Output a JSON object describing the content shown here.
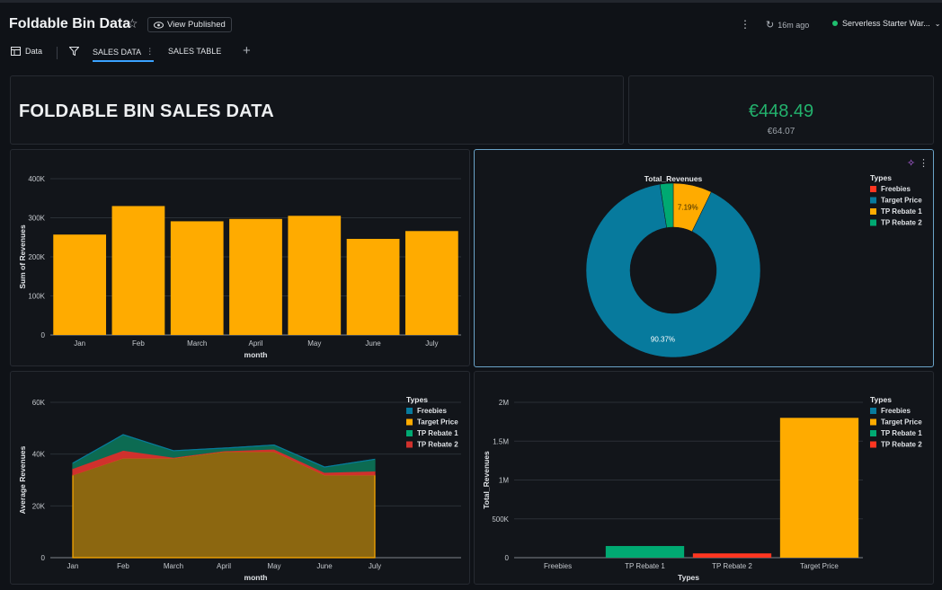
{
  "header": {
    "title": "Foldable Bin Data",
    "view_published": "View Published",
    "refreshed": "16m ago",
    "warehouse": "Serverless Starter War...",
    "status_color": "#1fbf6f"
  },
  "tabs": {
    "data_label": "Data",
    "sales_data": "SALES DATA",
    "sales_table": "SALES TABLE"
  },
  "banner": {
    "title": "FOLDABLE BIN SALES DATA"
  },
  "kpi": {
    "value": "€448.49",
    "sub": "€64.07"
  },
  "colors": {
    "orange": "#ffab00",
    "blue": "#077a9d",
    "green": "#00a972",
    "red": "#ff3621",
    "area_fill": "#8c6710"
  },
  "chart_data": [
    {
      "type": "bar",
      "xlabel": "month",
      "ylabel": "Sum of Revenues",
      "categories": [
        "Jan",
        "Feb",
        "March",
        "April",
        "May",
        "June",
        "July"
      ],
      "values": [
        257000,
        330000,
        291000,
        297000,
        305000,
        246000,
        266000
      ],
      "ylim": [
        0,
        400000
      ],
      "yticks": [
        "0",
        "100K",
        "200K",
        "300K",
        "400K"
      ],
      "color": "#ffab00"
    },
    {
      "type": "pie",
      "title": "Total_Revenues",
      "legend_title": "Types",
      "legend": [
        "Freebies",
        "Target Price",
        "TP Rebate 1",
        "TP Rebate 2"
      ],
      "slices": [
        {
          "name": "TP Rebate 1",
          "value": 7.19,
          "color": "#ffab00",
          "label": "7.19%"
        },
        {
          "name": "Target Price",
          "value": 90.37,
          "color": "#077a9d",
          "label": "90.37%"
        },
        {
          "name": "TP Rebate 2",
          "value": 2.44,
          "color": "#00a972",
          "label": ""
        }
      ],
      "legend_colors": [
        "#ff3621",
        "#077a9d",
        "#ffab00",
        "#00a972"
      ]
    },
    {
      "type": "area",
      "xlabel": "month",
      "ylabel": "Average Revenues",
      "legend_title": "Types",
      "categories": [
        "Jan",
        "Feb",
        "March",
        "April",
        "May",
        "June",
        "July"
      ],
      "ylim": [
        0,
        60000
      ],
      "yticks": [
        "0",
        "20K",
        "40K",
        "60K"
      ],
      "series": [
        {
          "name": "Freebies",
          "values": [
            0,
            0,
            0,
            0,
            0,
            0,
            0
          ],
          "color": "#077a9d"
        },
        {
          "name": "Target Price",
          "values": [
            32000,
            38500,
            38500,
            41000,
            41000,
            32000,
            32000
          ],
          "color": "#ffab00"
        },
        {
          "name": "TP Rebate 1",
          "values": [
            2000,
            6000,
            2500,
            1000,
            1500,
            2000,
            4500
          ],
          "color": "#0c6b52"
        },
        {
          "name": "TP Rebate 2",
          "values": [
            2500,
            3000,
            300,
            300,
            1000,
            1000,
            1500
          ],
          "color": "#d0312d"
        }
      ]
    },
    {
      "type": "bar",
      "xlabel": "Types",
      "ylabel": "Total_Revenues",
      "legend_title": "Types",
      "categories": [
        "Freebies",
        "TP Rebate 1",
        "TP Rebate 2",
        "Target Price"
      ],
      "values": [
        0,
        150000,
        55000,
        1800000
      ],
      "colors": [
        "#077a9d",
        "#00a972",
        "#ff3621",
        "#ffab00"
      ],
      "ylim": [
        0,
        2000000
      ],
      "yticks": [
        "0",
        "500K",
        "1M",
        "1.5M",
        "2M"
      ],
      "legend": [
        "Freebies",
        "Target Price",
        "TP Rebate 1",
        "TP Rebate 2"
      ],
      "legend_colors": [
        "#077a9d",
        "#ffab00",
        "#00a972",
        "#ff3621"
      ]
    }
  ]
}
